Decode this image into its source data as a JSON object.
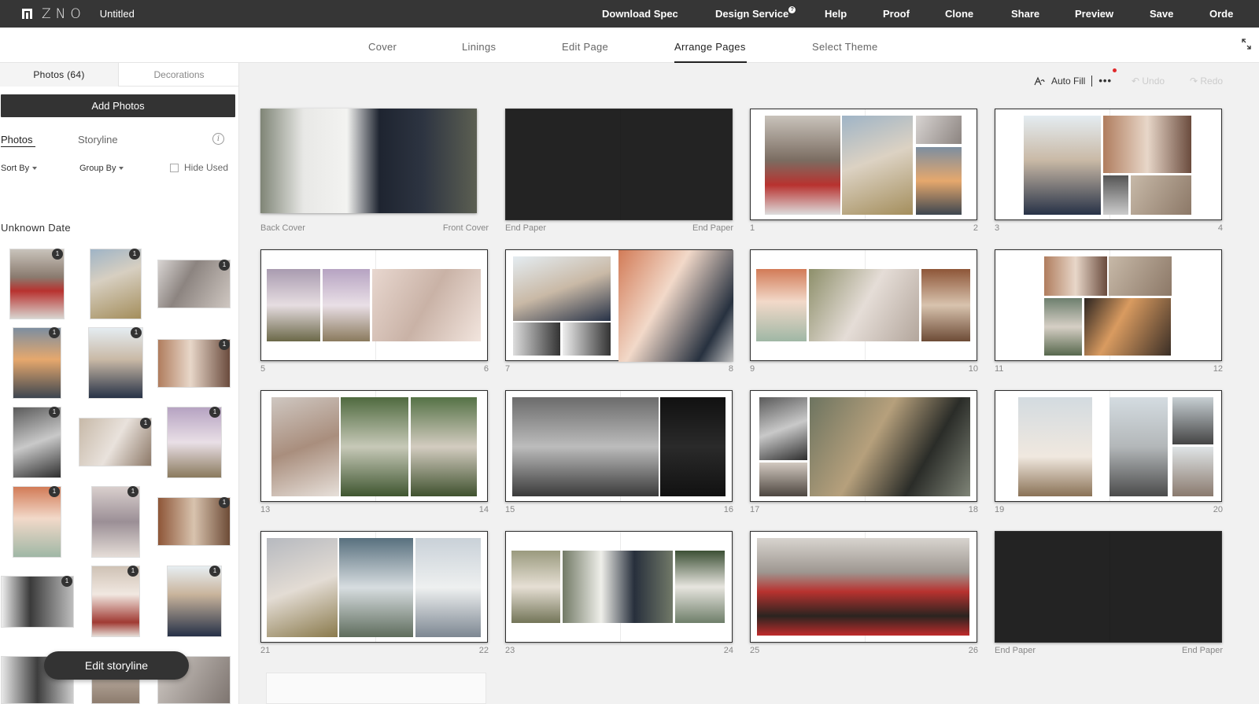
{
  "app": {
    "brand": "ZNO",
    "doc_title": "Untitled"
  },
  "top_nav": [
    "Download Spec",
    "Design Service",
    "Help",
    "Proof",
    "Clone",
    "Share",
    "Preview",
    "Save",
    "Orde"
  ],
  "tabs": [
    "Cover",
    "Linings",
    "Edit Page",
    "Arrange Pages",
    "Select Theme"
  ],
  "active_tab": "Arrange Pages",
  "left_panel": {
    "tabs": [
      "Photos (64)",
      "Decorations"
    ],
    "add_photos": "Add Photos",
    "sub_tabs": [
      "Photos",
      "Storyline"
    ],
    "sort_by": "Sort By",
    "group_by": "Group By",
    "hide_used": "Hide Used",
    "date_group": "Unknown Date",
    "badge": "1",
    "edit_storyline": "Edit storyline"
  },
  "toolbar": {
    "auto_fill": "Auto Fill",
    "more": "•••",
    "undo": "Undo",
    "redo": "Redo"
  },
  "colors": {
    "topbar": "#363636",
    "accent_dot": "#e0282a",
    "page_dark": "#232323"
  },
  "spreads": [
    {
      "left": "Back Cover",
      "right": "Front Cover"
    },
    {
      "left": "End Paper",
      "right": "End Paper"
    },
    {
      "left": "1",
      "right": "2"
    },
    {
      "left": "3",
      "right": "4"
    },
    {
      "left": "5",
      "right": "6"
    },
    {
      "left": "7",
      "right": "8"
    },
    {
      "left": "9",
      "right": "10"
    },
    {
      "left": "11",
      "right": "12"
    },
    {
      "left": "13",
      "right": "14"
    },
    {
      "left": "15",
      "right": "16"
    },
    {
      "left": "17",
      "right": "18"
    },
    {
      "left": "19",
      "right": "20"
    },
    {
      "left": "21",
      "right": "22"
    },
    {
      "left": "23",
      "right": "24"
    },
    {
      "left": "25",
      "right": "26"
    },
    {
      "left": "End Paper",
      "right": "End Paper"
    }
  ]
}
